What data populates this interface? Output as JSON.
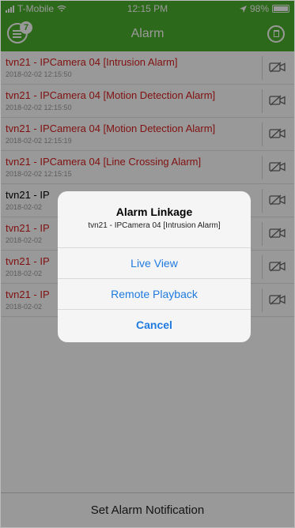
{
  "status_bar": {
    "carrier": "T-Mobile",
    "time": "12:15 PM",
    "battery": "98%",
    "battery_level": 0.98
  },
  "navbar": {
    "title": "Alarm",
    "badge_count": "7"
  },
  "alarms": [
    {
      "title": "tvn21 - IPCamera 04 [Intrusion Alarm]",
      "time": "2018-02-02 12:15:50"
    },
    {
      "title": "tvn21 - IPCamera 04 [Motion Detection Alarm]",
      "time": "2018-02-02 12:15:50"
    },
    {
      "title": "tvn21 - IPCamera 04 [Motion Detection Alarm]",
      "time": "2018-02-02 12:15:19"
    },
    {
      "title": "tvn21 - IPCamera 04 [Line Crossing Alarm]",
      "time": "2018-02-02 12:15:15"
    },
    {
      "title": "tvn21 - IP",
      "time": "2018-02-02",
      "title_color": "#000000"
    },
    {
      "title": "tvn21 - IP",
      "time": "2018-02-02"
    },
    {
      "title": "tvn21 - IP",
      "time": "2018-02-02"
    },
    {
      "title": "tvn21 - IP",
      "time": "2018-02-02"
    }
  ],
  "dialog": {
    "title": "Alarm Linkage",
    "subtitle": "tvn21 - IPCamera 04 [Intrusion Alarm]",
    "actions": [
      "Live View",
      "Remote Playback",
      "Cancel"
    ]
  },
  "footer": {
    "label": "Set Alarm Notification"
  },
  "colors": {
    "header_green": "#4caf2c",
    "alarm_red": "#d81e1e",
    "link_blue": "#1f7ae0"
  }
}
